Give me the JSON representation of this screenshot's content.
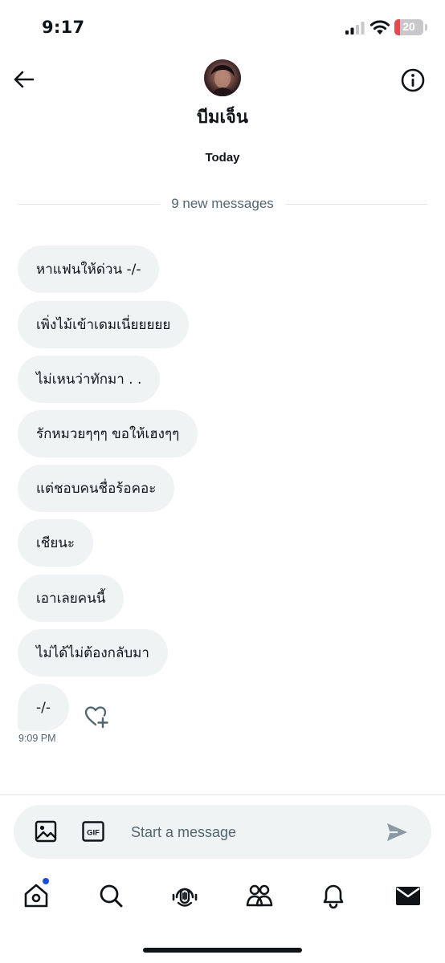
{
  "status_bar": {
    "time": "9:17",
    "battery_level": "20",
    "battery_fraction": 0.2,
    "signal_icon": "cellular-signal-icon",
    "wifi_icon": "wifi-icon"
  },
  "header": {
    "back_icon": "arrow-left-icon",
    "info_icon": "info-circle-icon",
    "contact_name": "บีมเจ็น"
  },
  "conversation": {
    "date_label": "Today",
    "new_messages_label": "9 new messages",
    "messages": [
      {
        "text": "หาแฟนให้ด่วน -/-"
      },
      {
        "text": "เพิ่งไม้เข้าเดมเนี่ยยยยย"
      },
      {
        "text": "ไม่เหนว่าทักมา . ."
      },
      {
        "text": "รักหมวยๆๆๆ ขอให้เฮงๆๆ"
      },
      {
        "text": "แต่ชอบคนชื่อร้อคอะ"
      },
      {
        "text": "เชียนะ"
      },
      {
        "text": "เอาเลยคนนี้"
      },
      {
        "text": "ไม่ได้ไม่ต้องกลับมา"
      },
      {
        "text": "-/-"
      }
    ],
    "last_message_time": "9:09 PM",
    "reaction_icon": "heart-plus-icon"
  },
  "composer": {
    "placeholder": "Start a message",
    "value": "",
    "media_icon": "image-icon",
    "gif_icon": "gif-icon",
    "gif_label": "GIF",
    "send_icon": "send-icon"
  },
  "bottom_nav": {
    "items": [
      {
        "icon": "home-icon",
        "has_notification": true
      },
      {
        "icon": "search-icon"
      },
      {
        "icon": "spaces-microphone-icon"
      },
      {
        "icon": "communities-icon"
      },
      {
        "icon": "bell-icon"
      },
      {
        "icon": "envelope-icon",
        "active": true
      }
    ]
  },
  "colors": {
    "text_primary": "#0f1419",
    "text_secondary": "#536471",
    "bubble_bg": "#eff3f4",
    "notification_dot": "#1d4ed8",
    "battery_low": "#e5484d"
  }
}
